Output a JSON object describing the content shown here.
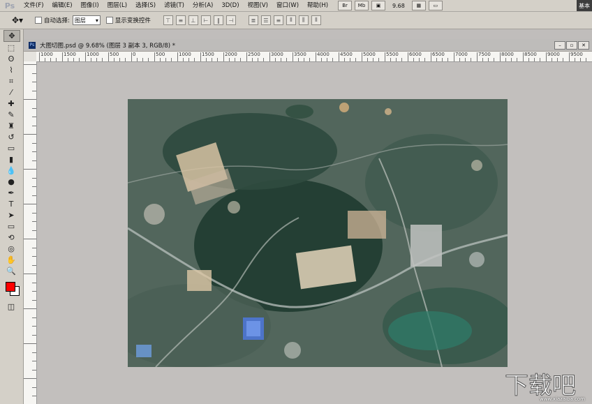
{
  "app": {
    "logo": "Ps",
    "workspace": "基本"
  },
  "menu": [
    "文件(F)",
    "编辑(E)",
    "图像(I)",
    "图层(L)",
    "选择(S)",
    "滤镜(T)",
    "分析(A)",
    "3D(D)",
    "视图(V)",
    "窗口(W)",
    "帮助(H)"
  ],
  "menu_right": {
    "br_label": "Br",
    "mb_label": "Mb",
    "zoom": "9.68"
  },
  "options": {
    "auto_select_label": "自动选择:",
    "auto_select_value": "图层",
    "show_transform_label": "显示变换控件"
  },
  "document": {
    "title": "大图切图.psd @ 9.68% (图层 3 副本 3, RGB/8) *",
    "ruler_labels": [
      "1000",
      "1500",
      "1000",
      "500",
      "0",
      "500",
      "1000",
      "1500",
      "2000",
      "2500",
      "3000",
      "3500",
      "4000",
      "4500",
      "5000",
      "5500",
      "6000",
      "6500",
      "7000",
      "7500",
      "8000",
      "8500",
      "9000",
      "9500",
      "10"
    ]
  },
  "watermark": {
    "text": "www.xiazaiba.com"
  },
  "colors": {
    "foreground": "#ff0000",
    "background": "#ffffff"
  }
}
